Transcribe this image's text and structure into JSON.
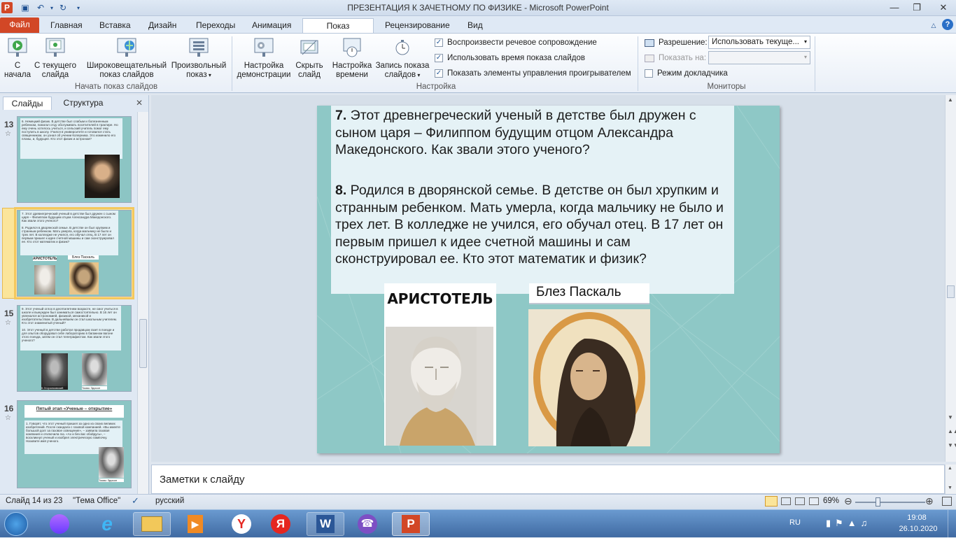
{
  "window": {
    "title": "ПРЕЗЕНТАЦИЯ К ЗАЧЕТНОМУ ПО ФИЗИКЕ  -  Microsoft PowerPoint",
    "app_letter": "P"
  },
  "tabs": [
    "Файл",
    "Главная",
    "Вставка",
    "Дизайн",
    "Переходы",
    "Анимация",
    "Показ слайдов",
    "Рецензирование",
    "Вид"
  ],
  "ribbon": {
    "start_group": {
      "label": "Начать показ слайдов",
      "from_start_1": "С",
      "from_start_2": "начала",
      "from_current_1": "С текущего",
      "from_current_2": "слайда",
      "broadcast_1": "Широковещательный",
      "broadcast_2": "показ слайдов",
      "custom_1": "Произвольный",
      "custom_2": "показ"
    },
    "setup_group": {
      "label": "Настройка",
      "setup_1": "Настройка",
      "setup_2": "демонстрации",
      "hide_1": "Скрыть",
      "hide_2": "слайд",
      "timing_1": "Настройка",
      "timing_2": "времени",
      "record_1": "Запись показа",
      "record_2": "слайдов",
      "checks": [
        "Воспроизвести речевое сопровождение",
        "Использовать время показа слайдов",
        "Показать элементы управления проигрывателем"
      ]
    },
    "monitors_group": {
      "label": "Мониторы",
      "resolution_label": "Разрешение:",
      "resolution_value": "Использовать текуще...",
      "show_on_label": "Показать на:",
      "presenter_view": "Режим докладчика"
    }
  },
  "left_pane": {
    "tab_slides": "Слайды",
    "tab_outline": "Структура",
    "thumbs": [
      {
        "num": "13",
        "text": "6. Немецкий физик. В детстве был слабым и болезненным ребенком, помогал отцу обслуживать посетителей в трактире. Но ему очень хотелось учиться, и сельский учитель помог ему поступить в школу. Учился в университете и готовился стать священником, он узнал об учении Коперника. Это изменило его планы, и, будущее. Кто этот физик и астроном?"
      },
      {
        "num": "14",
        "text_a": "7. Этот древнегреческий ученый в детстве был дружен с сыном царя – Филиппом будущим отцом Александра Македонского. Как звали этого ученого?",
        "text_b": "8. Родился в дворянской семье. В детстве он был хрупким и странным ребенком. Мать умерла, когда мальчику не было и трех лет. В колледже не учился, его обучал отец. В 17 лет он первым пришел к идее счетной машины и сам сконструировал ее. Кто этот математик и физик?",
        "cap1": "АРИСТОТЕЛЬ",
        "cap2": "Блез Паскаль"
      },
      {
        "num": "15",
        "text_a": "9. Этот ученый оглох в десятилетнем возрасте, не смог учиться в школе и вынужден был заниматься самостоятельно. В 16 лет он увлекался астрономией, физикой, механикой и изобретательством. В дальнейшем он стал школьным учителем. Кто этот знаменитый ученый?",
        "text_b": "10. Этот ученый в детстве работал продавцом газет в поезде и для опытов оборудовал себе лабораторию в багажном вагоне этого поезда, затем он стал телеграфистом. Как звали этого ученого?",
        "cap1": "К.Э.Циолковский",
        "cap2": "Томас Эдисон"
      },
      {
        "num": "16",
        "title": "Пятый этап «Ученые – открытие»",
        "text": "1. Говорят, что этот ученый пришел за одно из своих великих изобретений. После скандала с газовой компанией. «Вы имеете большой долг за газовое освещение», – заявила газовая компания и отключила газ. «Ах и без вас обойдусь», – воскликнул ученый и изобрел электрическую лампочку. Назовите имя ученого.",
        "cap": "Томас Эдисон"
      }
    ]
  },
  "slide": {
    "q7_num": "7.",
    "q7": " Этот древнегреческий ученый в детстве был дружен с сыном царя – Филиппом будущим отцом Александра Македонского. Как звали этого ученого?",
    "q8_num": "8.",
    "q8": " Родился в дворянской семье. В детстве он был хрупким и странным ребенком. Мать умерла, когда мальчику не было и трех лет. В колледже не учился, его обучал отец. В 17 лет он первым пришел к идее счетной машины и сам сконструировал ее. Кто этот математик и физик?",
    "caption_aristotle": "АРИСТОТЕЛЬ",
    "caption_pascal": "Блез Паскаль"
  },
  "notes_placeholder": "Заметки к слайду",
  "status": {
    "slide_info": "Слайд 14 из 23",
    "theme": "\"Тема Office\"",
    "language": "русский",
    "zoom": "69%",
    "zoom_level": 0.69
  },
  "taskbar": {
    "lang": "RU",
    "time": "19:08",
    "date": "26.10.2020"
  }
}
